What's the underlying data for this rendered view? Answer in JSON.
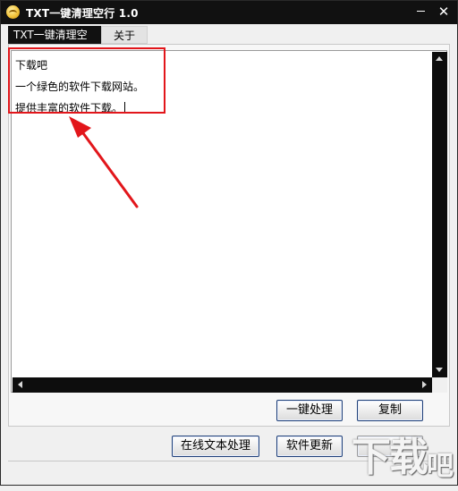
{
  "window": {
    "title": "TXT一键清理空行 1.0",
    "minimize_icon": "minimize-icon",
    "close_label": "✕"
  },
  "tabs": [
    {
      "label": "TXT一键清理空行",
      "active": true
    },
    {
      "label": "关于",
      "active": false
    }
  ],
  "editor": {
    "text": "下载吧\n一个绿色的软件下载网站。\n提供丰富的软件下载。"
  },
  "buttons": {
    "process": "一键处理",
    "copy": "复制",
    "online": "在线文本处理",
    "update": "软件更新"
  },
  "watermark": {
    "text": [
      "下",
      "载",
      "吧"
    ]
  },
  "colors": {
    "titlebar": "#111111",
    "annotation": "#e2161b",
    "scrollbar": "#0d0d0d",
    "button_border": "#1e3f78"
  }
}
